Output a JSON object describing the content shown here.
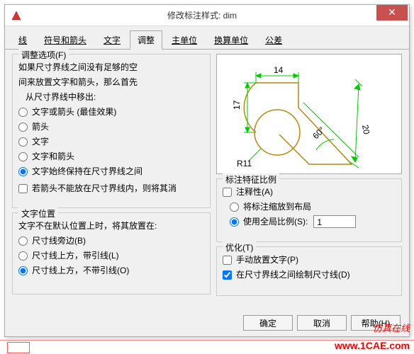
{
  "title": "修改标注样式: dim",
  "tabs": [
    "线",
    "符号和箭头",
    "文字",
    "调整",
    "主单位",
    "换算单位",
    "公差"
  ],
  "active_tab": 3,
  "fit_options": {
    "title": "调整选项(F)",
    "desc1": "如果尺寸界线之间没有足够的空",
    "desc2": "间来放置文字和箭头，那么首先",
    "desc3": "从尺寸界线中移出:",
    "o1": "文字或箭头 (最佳效果)",
    "o2": "箭头",
    "o3": "文字",
    "o4": "文字和箭头",
    "o5": "文字始终保持在尺寸界线之间",
    "chk": "若箭头不能放在尺寸界线内，则将其消"
  },
  "text_pos": {
    "title": "文字位置",
    "desc": "文字不在默认位置上时，将其放置在:",
    "o1": "尺寸线旁边(B)",
    "o2": "尺寸线上方，带引线(L)",
    "o3": "尺寸线上方，不带引线(O)"
  },
  "scale": {
    "title": "标注特征比例",
    "a": "注释性(A)",
    "b": "将标注缩放到布局",
    "c": "使用全局比例(S):",
    "val": "1"
  },
  "tune": {
    "title": "优化(T)",
    "a": "手动放置文字(P)",
    "b": "在尺寸界线之间绘制尺寸线(D)"
  },
  "buttons": {
    "ok": "确定",
    "cancel": "取消",
    "help": "帮助(H)"
  },
  "watermark": "仿真在线",
  "url": "www.1CAE.com",
  "chart_data": {
    "type": "diagram",
    "annotations": [
      "14",
      "17",
      "R11",
      "60°",
      "20"
    ]
  }
}
